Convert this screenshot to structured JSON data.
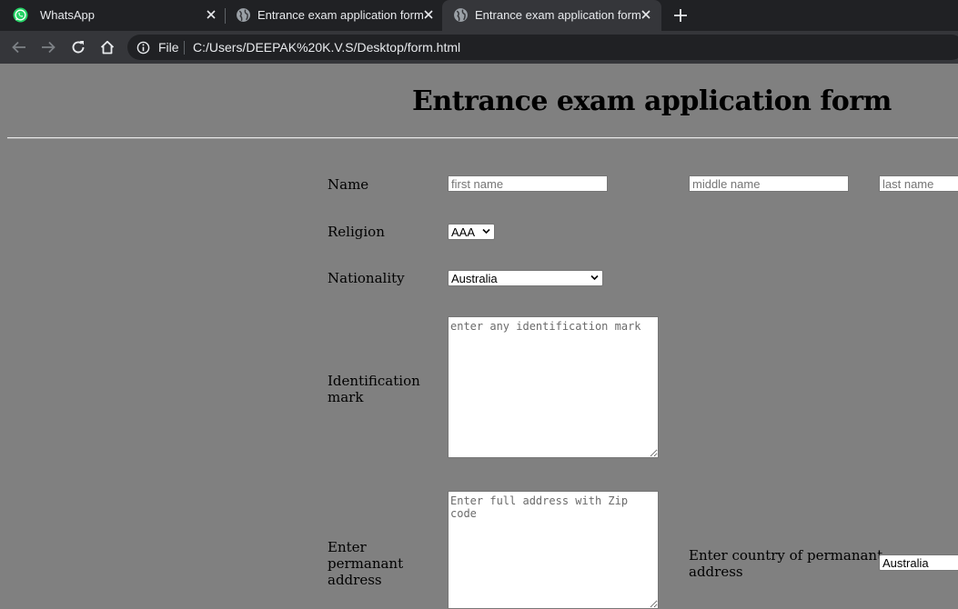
{
  "browser": {
    "tabs": [
      {
        "title": "WhatsApp",
        "icon": "whatsapp-icon",
        "active": false
      },
      {
        "title": "Entrance exam application form",
        "icon": "globe-icon",
        "active": false
      },
      {
        "title": "Entrance exam application form",
        "icon": "globe-icon",
        "active": true
      }
    ],
    "address": {
      "scheme_label": "File",
      "url": "C:/Users/DEEPAK%20K.V.S/Desktop/form.html"
    }
  },
  "page": {
    "heading": "Entrance exam application form",
    "form": {
      "name": {
        "label": "Name",
        "first_placeholder": "first name",
        "middle_placeholder": "middle name",
        "last_placeholder": "last name"
      },
      "religion": {
        "label": "Religion",
        "selected": "AAA"
      },
      "nationality": {
        "label": "Nationality",
        "selected": "Australia"
      },
      "identification": {
        "label_line1": "Identification",
        "label_line2": "mark",
        "placeholder": "enter any identification mark"
      },
      "address": {
        "label_line1": "Enter",
        "label_line2": "permanant",
        "label_line3": "address",
        "placeholder": "Enter full address with Zip code"
      },
      "country": {
        "label_line1": "Enter country of permanant",
        "label_line2": "address",
        "selected": "Australia"
      }
    }
  },
  "colors": {
    "page_background": "#808080",
    "chrome_dark": "#202124",
    "chrome_tab": "#35363a"
  }
}
